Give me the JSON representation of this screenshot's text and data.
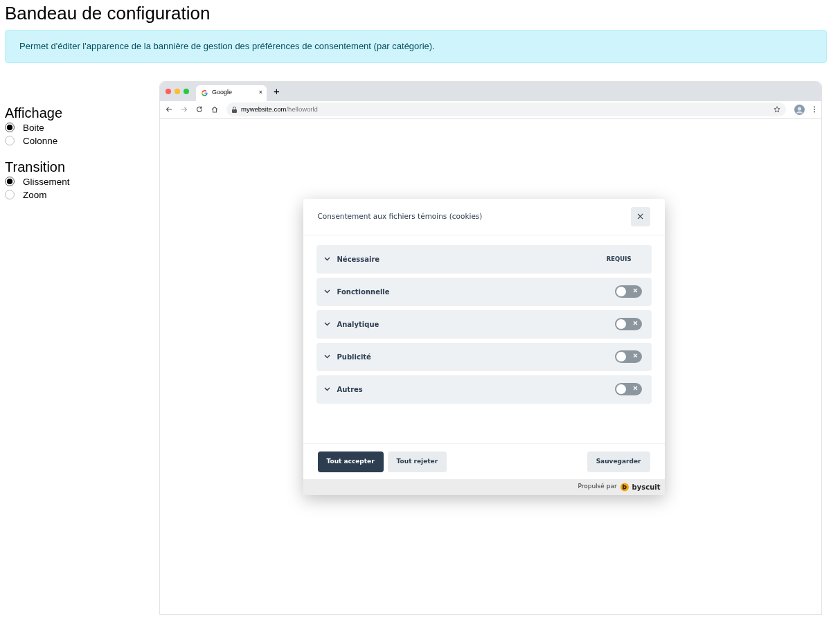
{
  "page_title": "Bandeau de configuration",
  "alert": "Permet d'éditer l'apparence de la bannière de gestion des préférences de consentement (par catégorie).",
  "option_groups": [
    {
      "title": "Affichage",
      "options": [
        {
          "label": "Boite",
          "selected": true
        },
        {
          "label": "Colonne",
          "selected": false
        }
      ]
    },
    {
      "title": "Transition",
      "options": [
        {
          "label": "Glissement",
          "selected": true
        },
        {
          "label": "Zoom",
          "selected": false
        }
      ]
    }
  ],
  "browser": {
    "tab_title": "Google",
    "tab_close": "×",
    "new_tab": "+",
    "url_host": "mywebsite.com",
    "url_path": "/helloworld"
  },
  "dialog": {
    "title": "Consentement aux fichiers témoins (cookies)",
    "close": "×",
    "categories": [
      {
        "label": "Nécessaire",
        "kind": "required",
        "badge": "REQUIS"
      },
      {
        "label": "Fonctionnelle",
        "kind": "toggle",
        "on": false
      },
      {
        "label": "Analytique",
        "kind": "toggle",
        "on": false
      },
      {
        "label": "Publicité",
        "kind": "toggle",
        "on": false
      },
      {
        "label": "Autres",
        "kind": "toggle",
        "on": false
      }
    ],
    "buttons": [
      {
        "label": "Tout accepter",
        "kind": "primary"
      },
      {
        "label": "Tout rejeter",
        "kind": "secondary"
      },
      {
        "label": "Sauvegarder",
        "kind": "save"
      }
    ],
    "powered_by": "Propulsé par",
    "brand": "byscuit"
  }
}
